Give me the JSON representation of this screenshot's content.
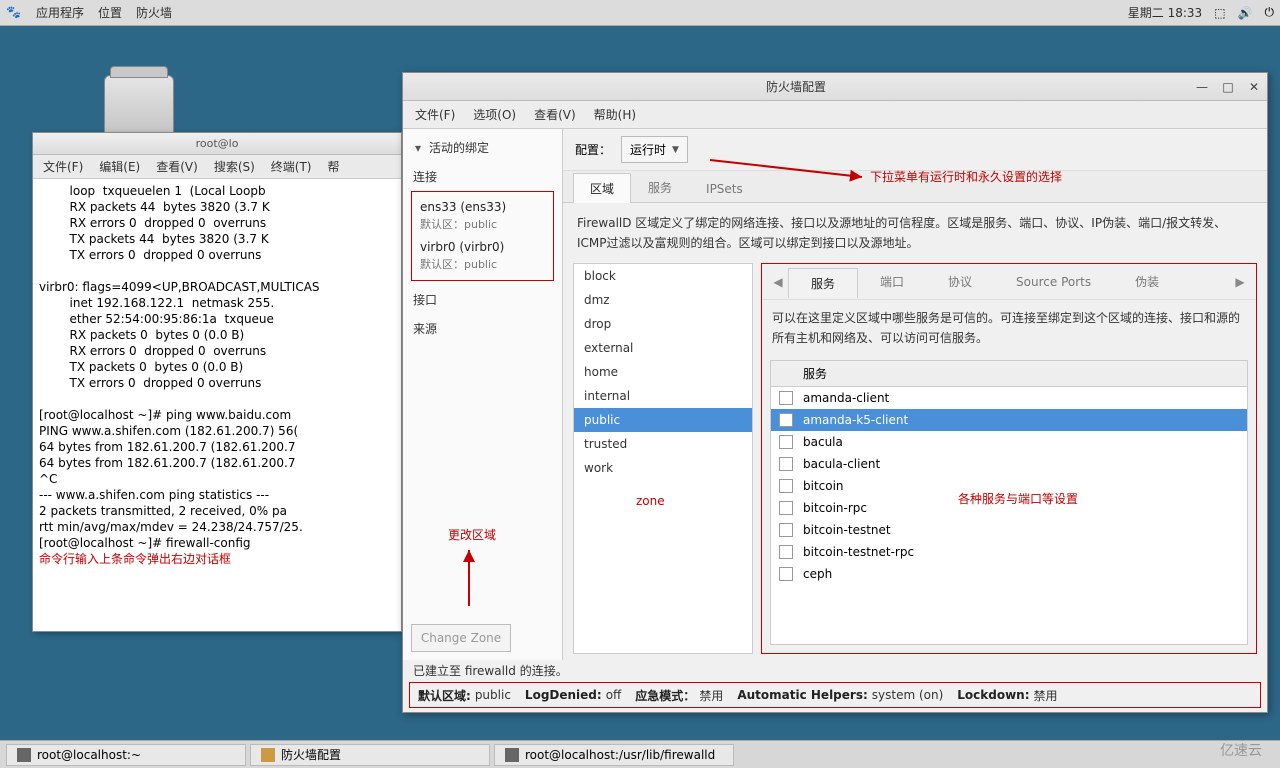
{
  "topbar": {
    "menus": [
      "应用程序",
      "位置",
      "防火墙"
    ],
    "datetime": "星期二 18:33"
  },
  "terminal": {
    "title": "root@lo",
    "menus": [
      "文件(F)",
      "编辑(E)",
      "查看(V)",
      "搜索(S)",
      "终端(T)",
      "帮"
    ],
    "body": "        loop  txqueuelen 1  (Local Loopb\n        RX packets 44  bytes 3820 (3.7 K\n        RX errors 0  dropped 0  overruns\n        TX packets 44  bytes 3820 (3.7 K\n        TX errors 0  dropped 0 overruns \n\nvirbr0: flags=4099<UP,BROADCAST,MULTICAS\n        inet 192.168.122.1  netmask 255.\n        ether 52:54:00:95:86:1a  txqueue\n        RX packets 0  bytes 0 (0.0 B)\n        RX errors 0  dropped 0  overruns\n        TX packets 0  bytes 0 (0.0 B)\n        TX errors 0  dropped 0 overruns \n\n[root@localhost ~]# ping www.baidu.com\nPING www.a.shifen.com (182.61.200.7) 56(\n64 bytes from 182.61.200.7 (182.61.200.7\n64 bytes from 182.61.200.7 (182.61.200.7\n^C\n--- www.a.shifen.com ping statistics ---\n2 packets transmitted, 2 received, 0% pa\nrtt min/avg/max/mdev = 24.238/24.757/25.\n[root@localhost ~]# firewall-config",
    "annotation": "命令行输入上条命令弹出右边对话框"
  },
  "firewall": {
    "title": "防火墙配置",
    "menus": [
      "文件(F)",
      "选项(O)",
      "查看(V)",
      "帮助(H)"
    ],
    "left": {
      "header": "活动的绑定",
      "section_conn": "连接",
      "conns": [
        {
          "name": "ens33 (ens33)",
          "sub": "默认区：public"
        },
        {
          "name": "virbr0 (virbr0)",
          "sub": "默认区：public"
        }
      ],
      "section_iface": "接口",
      "section_source": "来源",
      "change_zone": "Change Zone"
    },
    "config_label": "配置：",
    "config_value": "运行时",
    "tabs": [
      "区域",
      "服务",
      "IPSets"
    ],
    "zone_desc": "FirewallD 区域定义了绑定的网络连接、接口以及源地址的可信程度。区域是服务、端口、协议、IP伪装、端口/报文转发、ICMP过滤以及富规则的组合。区域可以绑定到接口以及源地址。",
    "zones": [
      "block",
      "dmz",
      "drop",
      "external",
      "home",
      "internal",
      "public",
      "trusted",
      "work"
    ],
    "selected_zone": "public",
    "sub_tabs": [
      "服务",
      "端口",
      "协议",
      "Source Ports",
      "伪装"
    ],
    "services_desc": "可以在这里定义区域中哪些服务是可信的。可连接至绑定到这个区域的连接、接口和源的所有主机和网络及、可以访问可信服务。",
    "svc_header": "服务",
    "services": [
      "amanda-client",
      "amanda-k5-client",
      "bacula",
      "bacula-client",
      "bitcoin",
      "bitcoin-rpc",
      "bitcoin-testnet",
      "bitcoin-testnet-rpc",
      "ceph"
    ],
    "selected_service": "amanda-k5-client",
    "status_connected": "已建立至 firewalld 的连接。",
    "status_bar": [
      {
        "label": "默认区域:",
        "value": "public"
      },
      {
        "label": "LogDenied:",
        "value": "off"
      },
      {
        "label": "应急模式：",
        "value": "禁用"
      },
      {
        "label": "Automatic Helpers:",
        "value": "system (on)"
      },
      {
        "label": "Lockdown:",
        "value": "禁用"
      }
    ]
  },
  "annotations": {
    "dropdown_hint": "下拉菜单有运行时和永久设置的选择",
    "zone_label": "zone",
    "change_zone_label": "更改区域",
    "services_label": "各种服务与端口等设置"
  },
  "taskbar": {
    "items": [
      "root@localhost:~",
      "防火墙配置",
      "root@localhost:/usr/lib/firewalld"
    ]
  },
  "brand": "亿速云"
}
